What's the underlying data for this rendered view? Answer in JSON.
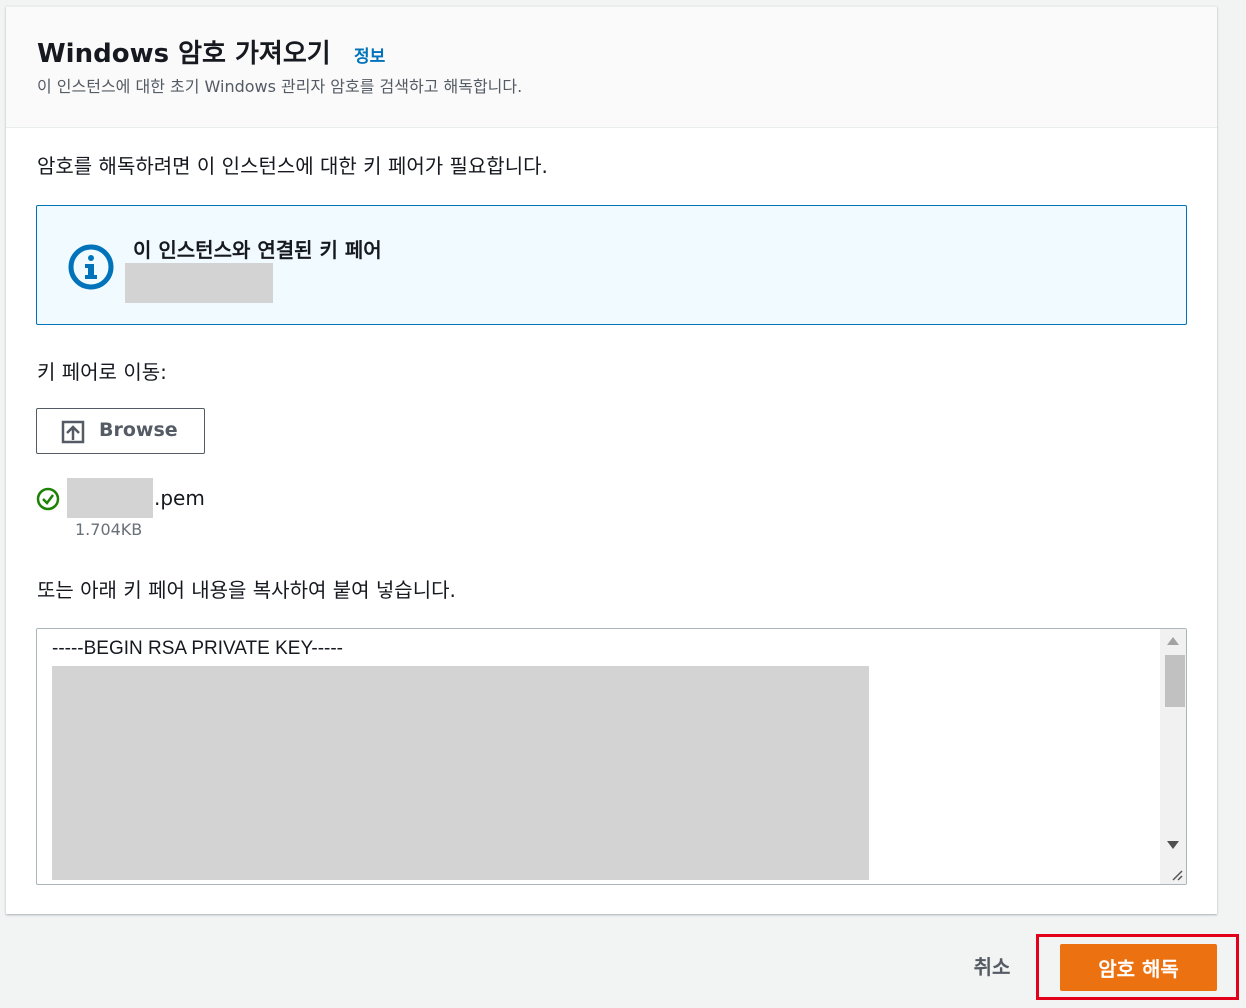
{
  "header": {
    "title": "Windows 암호 가져오기",
    "info_link": "정보",
    "description": "이 인스턴스에 대한 초기 Windows 관리자 암호를 검색하고 해독합니다."
  },
  "intro_text": "암호를 해독하려면 이 인스턴스에 대한 키 페어가 필요합니다.",
  "alert": {
    "icon": "info-icon",
    "title": "이 인스턴스와 연결된 키 페어"
  },
  "key_pair_navigate_label": "키 페어로 이동:",
  "browse_button": {
    "icon": "upload-icon",
    "label": "Browse"
  },
  "uploaded_file": {
    "status_icon": "check-circle-icon",
    "extension": ".pem",
    "size": "1.704KB"
  },
  "paste_label": "또는 아래 키 페어 내용을 복사하여 붙여 넣습니다.",
  "key_textarea": {
    "first_line": "-----BEGIN RSA PRIVATE KEY-----"
  },
  "footer": {
    "cancel_label": "취소",
    "decrypt_label": "암호 해독"
  },
  "colors": {
    "primary": "#ec7211",
    "link": "#0073bb",
    "info_border": "#0073bb",
    "info_bg": "#f1faff",
    "success": "#1d8102",
    "highlight": "#e3001b"
  }
}
